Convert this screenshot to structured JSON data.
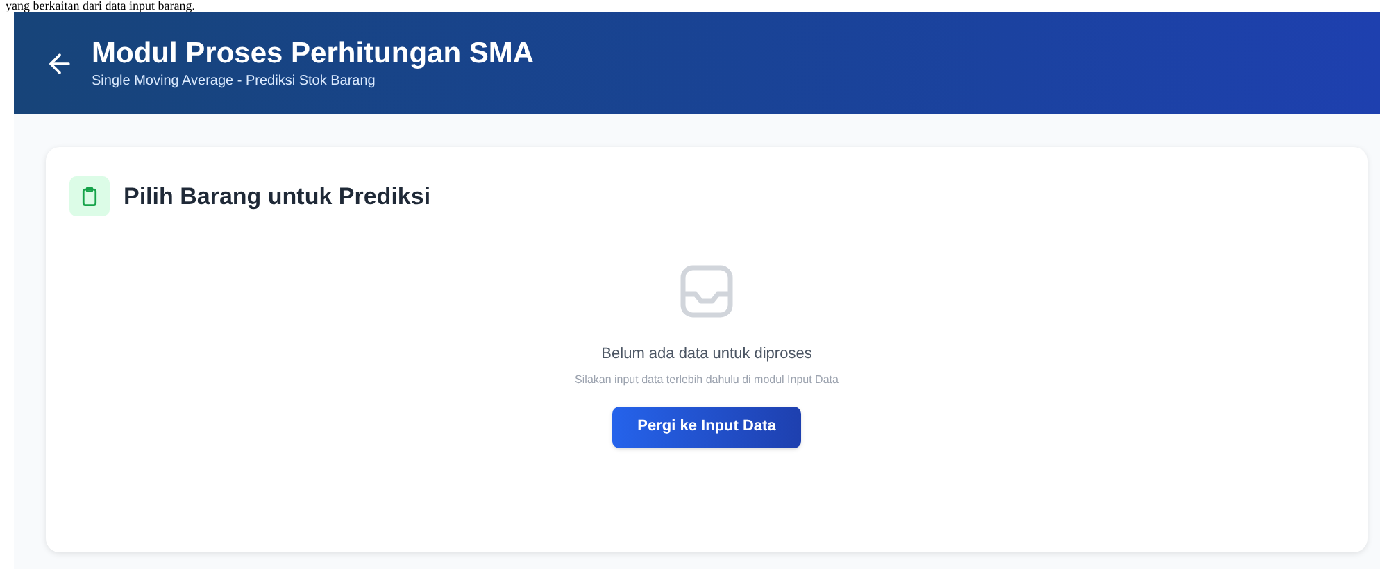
{
  "document_text": "yang berkaitan dari data input barang.",
  "header": {
    "title": "Modul Proses Perhitungan SMA",
    "subtitle": "Single Moving Average - Prediksi Stok Barang"
  },
  "card": {
    "title": "Pilih Barang untuk Prediksi",
    "empty_state": {
      "message": "Belum ada data untuk diproses",
      "hint": "Silakan input data terlebih dahulu di modul Input Data",
      "button": "Pergi ke Input Data"
    }
  }
}
